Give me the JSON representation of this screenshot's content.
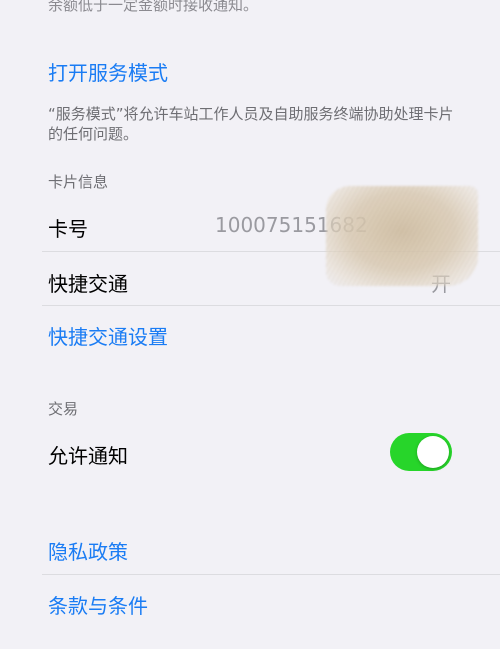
{
  "top_cut_text": "余额低于一定金额时接收通知。",
  "service_mode": {
    "link": "打开服务模式",
    "description": "“服务模式”将允许车站工作人员及自助服务终端协助处理卡片的任何问题。"
  },
  "card_info": {
    "header": "卡片信息",
    "card_number_label": "卡号",
    "card_number_value": "100075151682",
    "express_transit_label": "快捷交通",
    "express_transit_value": "开",
    "express_transit_settings": "快捷交通设置"
  },
  "transactions": {
    "header": "交易",
    "allow_notifications_label": "允许通知",
    "allow_notifications_on": true
  },
  "links": {
    "privacy_policy": "隐私政策",
    "terms": "条款与条件"
  },
  "colors": {
    "accent": "#1a7cf4",
    "toggle_on": "#27d52a",
    "background": "#f2f1f6"
  }
}
